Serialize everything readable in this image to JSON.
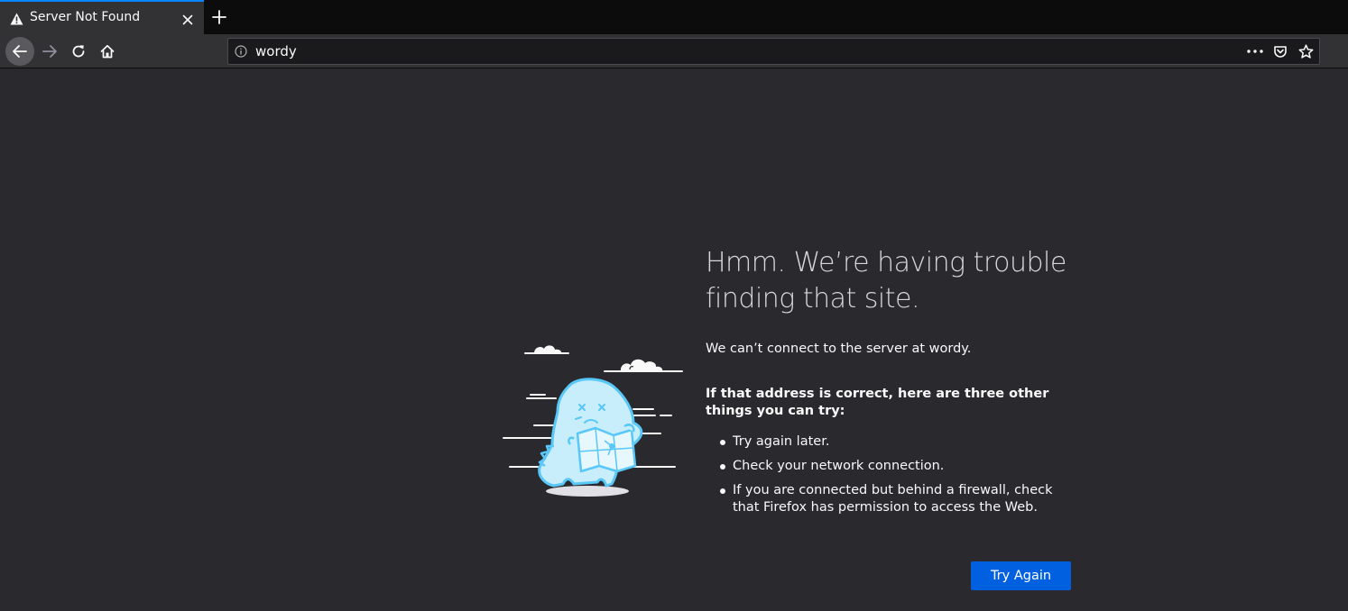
{
  "tab": {
    "title": "Server Not Found",
    "icon": "warning-icon"
  },
  "urlbar": {
    "value": "wordy"
  },
  "error": {
    "title": "Hmm. We’re having trouble finding that site.",
    "description": "We can’t connect to the server at wordy.",
    "suggest_heading": "If that address is correct, here are three other things you can try:",
    "suggestions": [
      "Try again later.",
      "Check your network connection.",
      "If you are connected but behind a firewall, check that Firefox has permission to access the Web."
    ],
    "button_label": "Try Again"
  },
  "colors": {
    "accent": "#0a84ff",
    "button": "#0060df",
    "page_bg": "#2a2a2e",
    "illustration": "#59c7f7"
  }
}
